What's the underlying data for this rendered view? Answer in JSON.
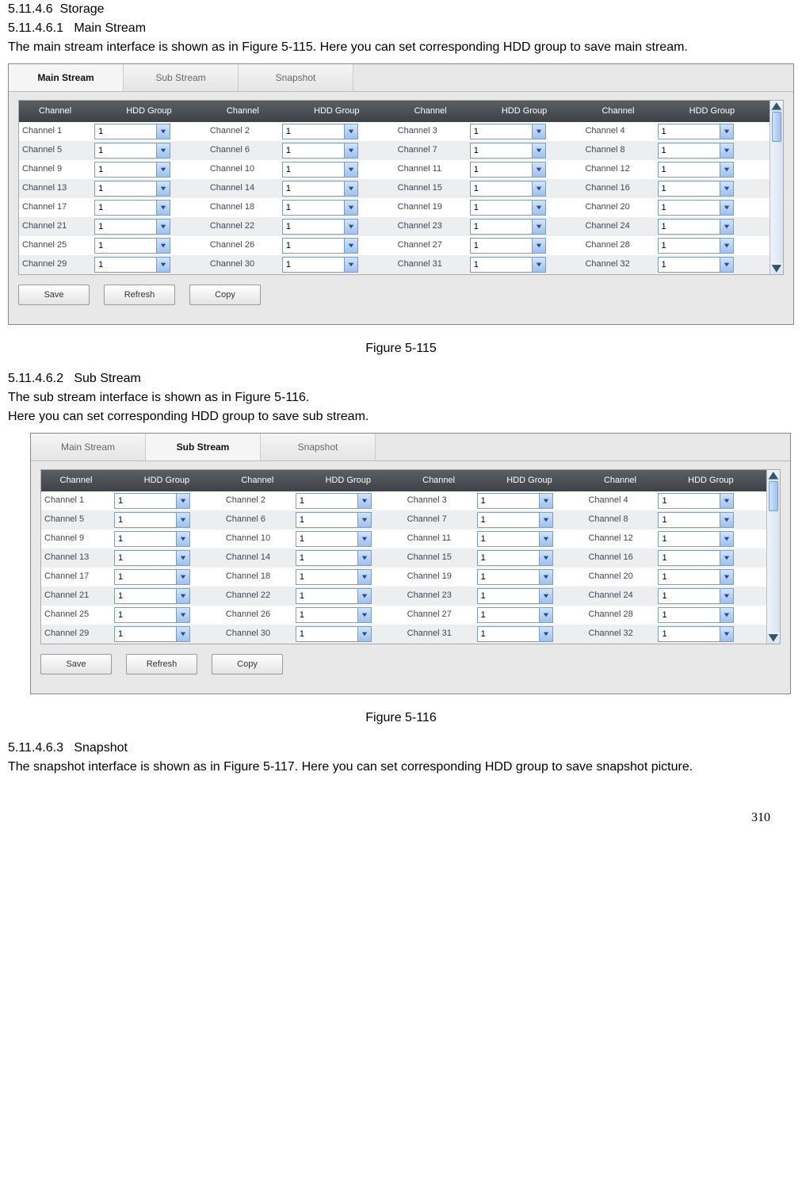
{
  "headings": {
    "storage_num": "5.11.4.6",
    "storage_label": "Storage",
    "main_num": "5.11.4.6.1",
    "main_label": "Main Stream",
    "sub_num": "5.11.4.6.2",
    "sub_label": "Sub Stream",
    "snap_num": "5.11.4.6.3",
    "snap_label": "Snapshot"
  },
  "body": {
    "main_p": "The main stream interface is shown as in Figure 5-115. Here you can set corresponding HDD group to save main stream.",
    "sub_p1": "The sub stream interface is shown as in Figure 5-116.",
    "sub_p2": "Here you can set corresponding HDD group to save sub stream.",
    "snap_p": "The snapshot interface is shown as in Figure 5-117. Here you can set corresponding HDD group to save snapshot picture."
  },
  "captions": {
    "fig1": "Figure 5-115",
    "fig2": "Figure 5-116"
  },
  "tabs": {
    "main": "Main Stream",
    "sub": "Sub Stream",
    "snap": "Snapshot"
  },
  "thead": {
    "channel": "Channel",
    "hdd": "HDD Group"
  },
  "buttons": {
    "save": "Save",
    "refresh": "Refresh",
    "copy": "Copy"
  },
  "rows": [
    [
      {
        "ch": "Channel 1",
        "v": "1"
      },
      {
        "ch": "Channel 2",
        "v": "1"
      },
      {
        "ch": "Channel 3",
        "v": "1"
      },
      {
        "ch": "Channel 4",
        "v": "1"
      }
    ],
    [
      {
        "ch": "Channel 5",
        "v": "1"
      },
      {
        "ch": "Channel 6",
        "v": "1"
      },
      {
        "ch": "Channel 7",
        "v": "1"
      },
      {
        "ch": "Channel 8",
        "v": "1"
      }
    ],
    [
      {
        "ch": "Channel 9",
        "v": "1"
      },
      {
        "ch": "Channel 10",
        "v": "1"
      },
      {
        "ch": "Channel 11",
        "v": "1"
      },
      {
        "ch": "Channel 12",
        "v": "1"
      }
    ],
    [
      {
        "ch": "Channel 13",
        "v": "1"
      },
      {
        "ch": "Channel 14",
        "v": "1"
      },
      {
        "ch": "Channel 15",
        "v": "1"
      },
      {
        "ch": "Channel 16",
        "v": "1"
      }
    ],
    [
      {
        "ch": "Channel 17",
        "v": "1"
      },
      {
        "ch": "Channel 18",
        "v": "1"
      },
      {
        "ch": "Channel 19",
        "v": "1"
      },
      {
        "ch": "Channel 20",
        "v": "1"
      }
    ],
    [
      {
        "ch": "Channel 21",
        "v": "1"
      },
      {
        "ch": "Channel 22",
        "v": "1"
      },
      {
        "ch": "Channel 23",
        "v": "1"
      },
      {
        "ch": "Channel 24",
        "v": "1"
      }
    ],
    [
      {
        "ch": "Channel 25",
        "v": "1"
      },
      {
        "ch": "Channel 26",
        "v": "1"
      },
      {
        "ch": "Channel 27",
        "v": "1"
      },
      {
        "ch": "Channel 28",
        "v": "1"
      }
    ],
    [
      {
        "ch": "Channel 29",
        "v": "1"
      },
      {
        "ch": "Channel 30",
        "v": "1"
      },
      {
        "ch": "Channel 31",
        "v": "1"
      },
      {
        "ch": "Channel 32",
        "v": "1"
      }
    ]
  ],
  "page_number": "310"
}
